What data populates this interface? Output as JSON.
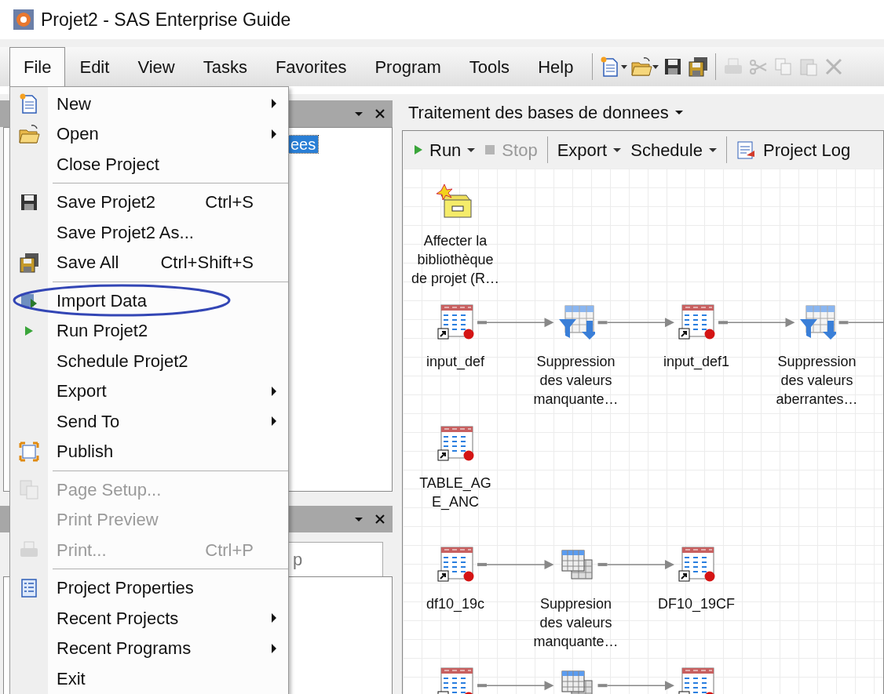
{
  "window": {
    "title": "Projet2 - SAS Enterprise Guide"
  },
  "menubar": [
    {
      "label": "File",
      "selected": true
    },
    {
      "label": "Edit",
      "selected": false
    },
    {
      "label": "View",
      "selected": false
    },
    {
      "label": "Tasks",
      "selected": false
    },
    {
      "label": "Favorites",
      "selected": false
    },
    {
      "label": "Program",
      "selected": false
    },
    {
      "label": "Tools",
      "selected": false
    },
    {
      "label": "Help",
      "selected": false
    }
  ],
  "toolbar": [
    {
      "kind": "button",
      "disabled": false,
      "dropdown": true
    },
    {
      "kind": "button",
      "disabled": false,
      "dropdown": true
    },
    {
      "kind": "button",
      "disabled": false,
      "dropdown": false
    },
    {
      "kind": "button",
      "disabled": false,
      "dropdown": false
    },
    {
      "kind": "separator"
    },
    {
      "kind": "button",
      "disabled": true,
      "dropdown": false
    },
    {
      "kind": "button",
      "disabled": true,
      "dropdown": false
    },
    {
      "kind": "button",
      "disabled": true,
      "dropdown": false
    },
    {
      "kind": "button",
      "disabled": true,
      "dropdown": false
    },
    {
      "kind": "button",
      "disabled": true,
      "dropdown": false
    }
  ],
  "file_menu": [
    {
      "kind": "item",
      "label": "New",
      "submenu": true,
      "disabled": false,
      "circled": false
    },
    {
      "kind": "item",
      "label": "Open",
      "submenu": true,
      "disabled": false,
      "circled": false
    },
    {
      "kind": "item",
      "label": "Close Project",
      "submenu": false,
      "disabled": false,
      "circled": false
    },
    {
      "kind": "separator"
    },
    {
      "kind": "item",
      "label": "Save Projet2",
      "shortcut": "Ctrl+S",
      "submenu": false,
      "disabled": false,
      "circled": false
    },
    {
      "kind": "item",
      "label": "Save Projet2 As...",
      "submenu": false,
      "disabled": false,
      "circled": false
    },
    {
      "kind": "item",
      "label": "Save All",
      "shortcut": "Ctrl+Shift+S",
      "submenu": false,
      "disabled": false,
      "circled": false
    },
    {
      "kind": "separator"
    },
    {
      "kind": "item",
      "label": "Import Data",
      "submenu": false,
      "disabled": false,
      "circled": true
    },
    {
      "kind": "item",
      "label": "Run Projet2",
      "submenu": false,
      "disabled": false,
      "circled": false
    },
    {
      "kind": "item",
      "label": "Schedule Projet2",
      "submenu": false,
      "disabled": false,
      "circled": false
    },
    {
      "kind": "item",
      "label": "Export",
      "submenu": true,
      "disabled": false,
      "circled": false
    },
    {
      "kind": "item",
      "label": "Send To",
      "submenu": true,
      "disabled": false,
      "circled": false
    },
    {
      "kind": "item",
      "label": "Publish",
      "submenu": false,
      "disabled": false,
      "circled": false
    },
    {
      "kind": "separator"
    },
    {
      "kind": "item",
      "label": "Page Setup...",
      "submenu": false,
      "disabled": true,
      "circled": false
    },
    {
      "kind": "item",
      "label": "Print Preview",
      "submenu": false,
      "disabled": true,
      "circled": false
    },
    {
      "kind": "item",
      "label": "Print...",
      "shortcut": "Ctrl+P",
      "submenu": false,
      "disabled": true,
      "circled": false
    },
    {
      "kind": "separator"
    },
    {
      "kind": "item",
      "label": "Project Properties",
      "submenu": false,
      "disabled": false,
      "circled": false
    },
    {
      "kind": "item",
      "label": "Recent Projects",
      "submenu": true,
      "disabled": false,
      "circled": false
    },
    {
      "kind": "item",
      "label": "Recent Programs",
      "submenu": true,
      "disabled": false,
      "circled": false
    },
    {
      "kind": "item",
      "label": "Exit",
      "submenu": false,
      "disabled": false,
      "circled": false
    }
  ],
  "project_tree": {
    "items": [
      {
        "label": "ees",
        "selected": true
      }
    ]
  },
  "bottom_pane": {
    "tabs": [
      {
        "label": "p",
        "selected": true
      }
    ]
  },
  "process_flow": {
    "title": "Traitement des bases de donnees",
    "toolbar": [
      {
        "kind": "run",
        "label": "Run",
        "dropdown": true,
        "disabled": false
      },
      {
        "kind": "stop",
        "label": "Stop",
        "dropdown": false,
        "disabled": true
      },
      {
        "kind": "separator"
      },
      {
        "kind": "plain",
        "label": "Export",
        "dropdown": true,
        "disabled": false
      },
      {
        "kind": "plain",
        "label": "Schedule",
        "dropdown": true,
        "disabled": false
      },
      {
        "kind": "separator"
      },
      {
        "kind": "log",
        "label": "Project Log",
        "dropdown": false,
        "disabled": false
      }
    ],
    "rows": [
      [
        {
          "kind": "library",
          "label": "Affecter la\nbibliothèque\nde projet (R…"
        }
      ],
      [
        {
          "kind": "dataset",
          "label": "input_def"
        },
        {
          "kind": "arrow"
        },
        {
          "kind": "filter",
          "label": "Suppression\ndes valeurs\nmanquante…"
        },
        {
          "kind": "arrow"
        },
        {
          "kind": "dataset",
          "label": "input_def1"
        },
        {
          "kind": "arrow"
        },
        {
          "kind": "filter",
          "label": "Suppression\ndes valeurs\naberrantes…"
        },
        {
          "kind": "arrow"
        }
      ],
      [
        {
          "kind": "dataset",
          "label": "TABLE_AG\nE_ANC"
        }
      ],
      [
        {
          "kind": "dataset",
          "label": "df10_19c"
        },
        {
          "kind": "arrow"
        },
        {
          "kind": "join",
          "label": "Suppresion\ndes valeurs\nmanquante…"
        },
        {
          "kind": "arrow"
        },
        {
          "kind": "dataset",
          "label": "DF10_19CF"
        }
      ],
      [
        {
          "kind": "dataset"
        },
        {
          "kind": "arrow"
        },
        {
          "kind": "join"
        },
        {
          "kind": "arrow"
        },
        {
          "kind": "dataset"
        }
      ]
    ]
  }
}
